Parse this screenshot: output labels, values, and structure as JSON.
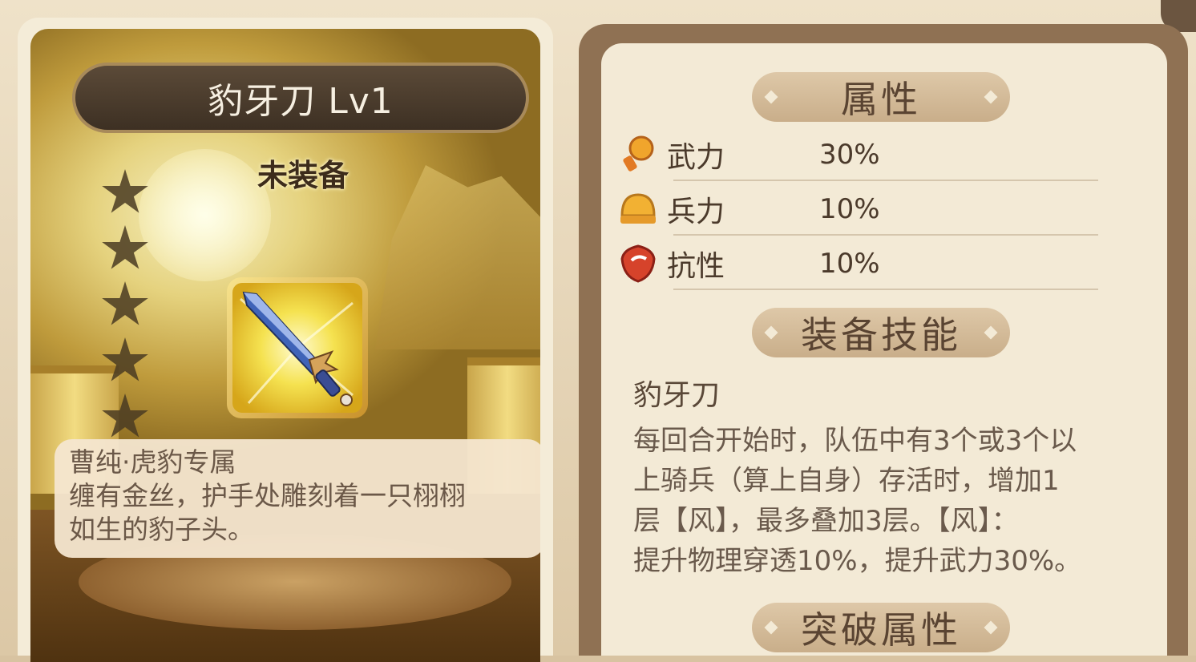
{
  "item": {
    "title": "豹牙刀 Lv1",
    "status": "未装备",
    "star_count": 5,
    "description_lines": [
      "曹纯·虎豹专属",
      "缠有金丝，护手处雕刻着一只栩栩",
      "如生的豹子头。"
    ]
  },
  "attributes": {
    "header": "属性",
    "rows": [
      {
        "icon": "fist-icon",
        "name": "武力",
        "value": "30%"
      },
      {
        "icon": "helmet-icon",
        "name": "兵力",
        "value": "10%"
      },
      {
        "icon": "shield-icon",
        "name": "抗性",
        "value": "10%"
      }
    ]
  },
  "skill": {
    "header": "装备技能",
    "name": "豹牙刀",
    "lines": [
      "每回合开始时，队伍中有3个或3个以",
      "上骑兵（算上自身）存活时，增加1",
      "层【风】，最多叠加3层。【风】：",
      "提升物理穿透10%，提升武力30%。"
    ]
  },
  "breakthrough": {
    "header": "突破属性"
  },
  "colors": {
    "panel_bg": "#f3ead6",
    "header_bg": "#d5bc98",
    "title_bar": "#4a3b2c",
    "text_dark": "#4b3a2b"
  }
}
